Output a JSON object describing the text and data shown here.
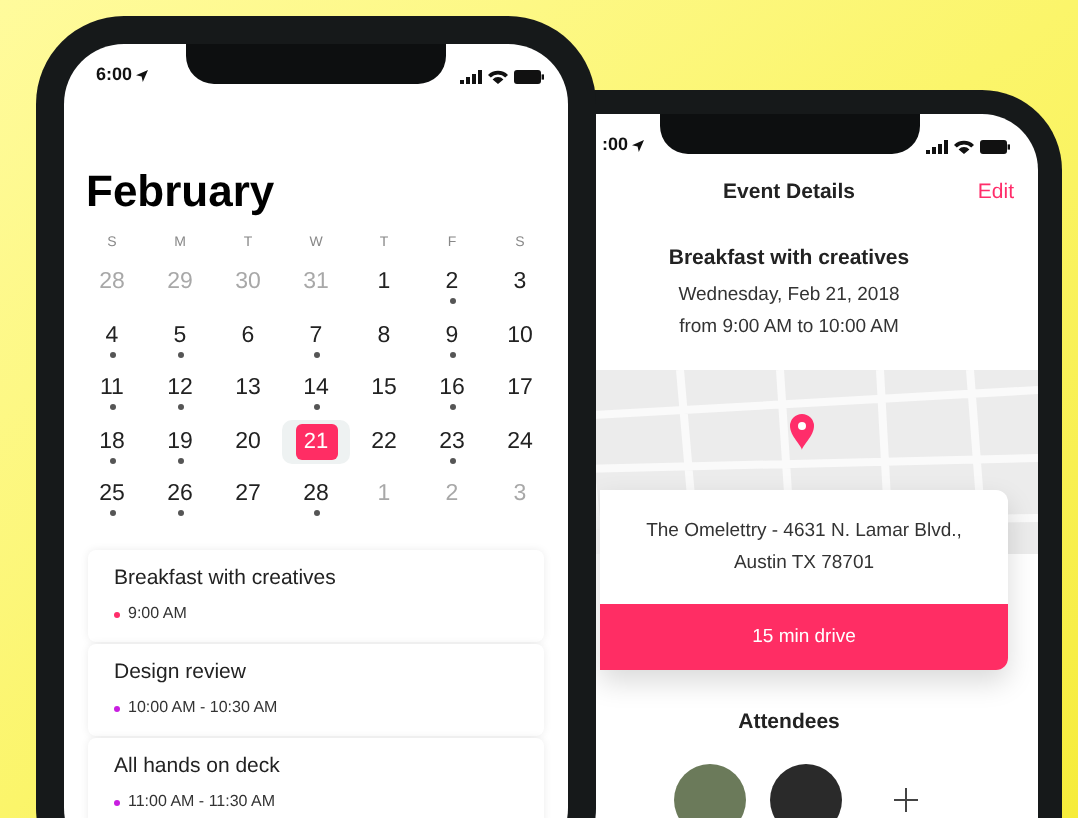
{
  "left_phone": {
    "status_time": "6:00",
    "month": "February",
    "weekdays": [
      "S",
      "M",
      "T",
      "W",
      "T",
      "F",
      "S"
    ],
    "days": [
      {
        "n": "28",
        "muted": true,
        "dot": false,
        "selected": false
      },
      {
        "n": "29",
        "muted": true,
        "dot": false,
        "selected": false
      },
      {
        "n": "30",
        "muted": true,
        "dot": false,
        "selected": false
      },
      {
        "n": "31",
        "muted": true,
        "dot": false,
        "selected": false
      },
      {
        "n": "1",
        "muted": false,
        "dot": false,
        "selected": false
      },
      {
        "n": "2",
        "muted": false,
        "dot": true,
        "selected": false
      },
      {
        "n": "3",
        "muted": false,
        "dot": false,
        "selected": false
      },
      {
        "n": "4",
        "muted": false,
        "dot": true,
        "selected": false
      },
      {
        "n": "5",
        "muted": false,
        "dot": true,
        "selected": false
      },
      {
        "n": "6",
        "muted": false,
        "dot": false,
        "selected": false
      },
      {
        "n": "7",
        "muted": false,
        "dot": true,
        "selected": false
      },
      {
        "n": "8",
        "muted": false,
        "dot": false,
        "selected": false
      },
      {
        "n": "9",
        "muted": false,
        "dot": true,
        "selected": false
      },
      {
        "n": "10",
        "muted": false,
        "dot": false,
        "selected": false
      },
      {
        "n": "11",
        "muted": false,
        "dot": true,
        "selected": false
      },
      {
        "n": "12",
        "muted": false,
        "dot": true,
        "selected": false
      },
      {
        "n": "13",
        "muted": false,
        "dot": false,
        "selected": false
      },
      {
        "n": "14",
        "muted": false,
        "dot": true,
        "selected": false
      },
      {
        "n": "15",
        "muted": false,
        "dot": false,
        "selected": false
      },
      {
        "n": "16",
        "muted": false,
        "dot": true,
        "selected": false
      },
      {
        "n": "17",
        "muted": false,
        "dot": false,
        "selected": false
      },
      {
        "n": "18",
        "muted": false,
        "dot": true,
        "selected": false
      },
      {
        "n": "19",
        "muted": false,
        "dot": true,
        "selected": false
      },
      {
        "n": "20",
        "muted": false,
        "dot": false,
        "selected": false
      },
      {
        "n": "21",
        "muted": false,
        "dot": false,
        "selected": true
      },
      {
        "n": "22",
        "muted": false,
        "dot": false,
        "selected": false
      },
      {
        "n": "23",
        "muted": false,
        "dot": true,
        "selected": false
      },
      {
        "n": "24",
        "muted": false,
        "dot": false,
        "selected": false
      },
      {
        "n": "25",
        "muted": false,
        "dot": true,
        "selected": false
      },
      {
        "n": "26",
        "muted": false,
        "dot": true,
        "selected": false
      },
      {
        "n": "27",
        "muted": false,
        "dot": false,
        "selected": false
      },
      {
        "n": "28",
        "muted": false,
        "dot": true,
        "selected": false
      },
      {
        "n": "1",
        "muted": true,
        "dot": false,
        "selected": false
      },
      {
        "n": "2",
        "muted": true,
        "dot": false,
        "selected": false
      },
      {
        "n": "3",
        "muted": true,
        "dot": false,
        "selected": false
      }
    ],
    "events": [
      {
        "title": "Breakfast with creatives",
        "time": "9:00 AM",
        "color": "#ff2d6a"
      },
      {
        "title": "Design review",
        "time": "10:00 AM - 10:30 AM",
        "color": "#c81ee0"
      },
      {
        "title": "All hands on deck",
        "time": "11:00 AM - 11:30 AM",
        "color": "#c81ee0"
      }
    ]
  },
  "right_phone": {
    "status_time": ":00",
    "title": "Event Details",
    "edit": "Edit",
    "event": {
      "title": "Breakfast with creatives",
      "date": "Wednesday, Feb 21, 2018",
      "time": "from 9:00 AM to 10:00 AM"
    },
    "address": [
      "The Omelettry - 4631 N. Lamar Blvd.,",
      "Austin TX 78701"
    ],
    "drive": "15 min drive",
    "attendees_heading": "Attendees"
  }
}
